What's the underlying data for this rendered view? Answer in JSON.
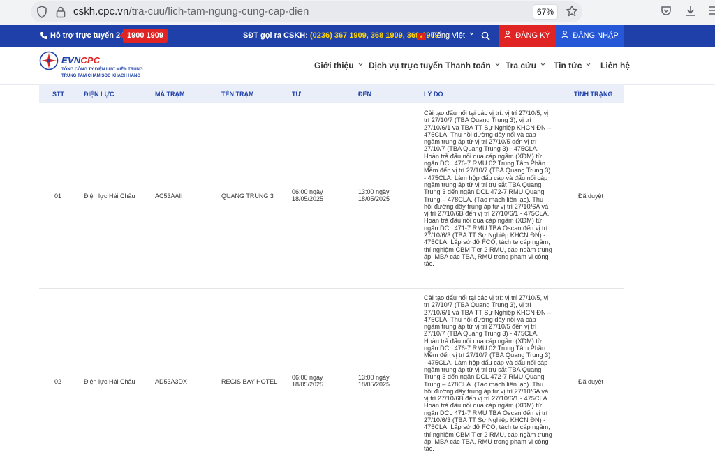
{
  "browser": {
    "url_host": "cskh.cpc.vn",
    "url_path": "/tra-cuu/lich-tam-ngung-cung-cap-dien",
    "zoom": "67%"
  },
  "topbar": {
    "hotline_label": "Hỗ trợ trực tuyến 24/7:",
    "hotline_number": "1900 1909",
    "cskh_label": "SĐT gọi ra CSKH:",
    "cskh_numbers": "(0236) 367 1909, 368 1909, 369 1909",
    "language": "Tiếng Việt",
    "register": "ĐĂNG KÝ",
    "login": "ĐĂNG NHẬP"
  },
  "header": {
    "logo_evn": "EVN",
    "logo_cpc": "CPC",
    "logo_sub1": "TỔNG CÔNG TY ĐIỆN LỰC MIỀN TRUNG",
    "logo_sub2": "TRUNG TÂM CHĂM SÓC KHÁCH HÀNG",
    "nav": [
      "Giới thiệu",
      "Dịch vụ trực tuyến",
      "Thanh toán",
      "Tra cứu",
      "Tin tức",
      "Liên hệ"
    ]
  },
  "table": {
    "columns": [
      "STT",
      "ĐIỆN LỰC",
      "MÃ TRẠM",
      "TÊN TRẠM",
      "TỪ",
      "ĐẾN",
      "LÝ DO",
      "TÌNH TRẠNG"
    ],
    "rows": [
      {
        "stt": "01",
        "dien_luc": "Điện lực Hải Châu",
        "ma_tram": "AC53AAII",
        "ten_tram": "QUANG TRUNG 3",
        "tu_1": "06:00 ngày",
        "tu_2": "18/05/2025",
        "den_1": "13:00 ngày",
        "den_2": "18/05/2025",
        "ly_do": "Cải tạo đấu nối tại các vị trí: vị trí 27/10/5, vị trí 27/10/7 (TBA Quang Trung 3), vị trí 27/10/6/1 và TBA TT Sự Nghiệp KHCN ĐN – 475CLA. Thu hồi đường dây nổi và cáp ngầm trung áp từ vị trí 27/10/5 đến vị trí 27/10/7 (TBA Quang Trung 3) - 475CLA. Hoàn trả đấu nối qua cáp ngầm (XDM) từ ngăn DCL 476-7 RMU 02 Trung Tâm Phần Mềm đến vị trí 27/10/7 (TBA Quang Trung 3) - 475CLA. Làm hộp đấu cáp và đấu nối cáp ngầm trung áp từ vị trí trụ sắt TBA Quang Trung 3 đến ngăn DCL 472-7 RMU Quang Trung – 478CLA. (Tạo mạch liên lạc). Thu hồi đường dây trung áp từ vị trí 27/10/6A và vị trí 27/10/6B đến vị trí 27/10/6/1 - 475CLA. Hoàn trả đấu nối qua cáp ngầm (XDM) từ ngăn DCL 471-7 RMU TBA Oscan đến vị trí 27/10/6/3 (TBA TT Sự Nghiệp KHCN ĐN) - 475CLA. Lắp sứ đỡ FCO, tách te cáp ngầm, thí nghiệm CBM Tier 2 RMU, cáp ngầm trung áp, MBA các TBA, RMU trong phạm vi công tác.",
        "tinh_trang": "Đã duyệt"
      },
      {
        "stt": "02",
        "dien_luc": "Điện lực Hải Châu",
        "ma_tram": "AD53A3DX",
        "ten_tram": "REGIS BAY HOTEL",
        "tu_1": "06:00 ngày",
        "tu_2": "18/05/2025",
        "den_1": "13:00 ngày",
        "den_2": "18/05/2025",
        "ly_do": "Cải tạo đấu nối tại các vị trí: vị trí 27/10/5, vị trí 27/10/7 (TBA Quang Trung 3), vị trí 27/10/6/1 và TBA TT Sự Nghiệp KHCN ĐN – 475CLA. Thu hồi đường dây nổi và cáp ngầm trung áp từ vị trí 27/10/5 đến vị trí 27/10/7 (TBA Quang Trung 3) - 475CLA. Hoàn trả đấu nối qua cáp ngầm (XDM) từ ngăn DCL 476-7 RMU 02 Trung Tâm Phần Mềm đến vị trí 27/10/7 (TBA Quang Trung 3) - 475CLA. Làm hộp đấu cáp và đấu nối cáp ngầm trung áp từ vị trí trụ sắt TBA Quang Trung 3 đến ngăn DCL 472-7 RMU Quang Trung – 478CLA. (Tạo mạch liên lạc). Thu hồi đường dây trung áp từ vị trí 27/10/6A và vị trí 27/10/6B đến vị trí 27/10/6/1 - 475CLA. Hoàn trả đấu nối qua cáp ngầm (XDM) từ ngăn DCL 471-7 RMU TBA Oscan đến vị trí 27/10/6/3 (TBA TT Sự Nghiệp KHCN ĐN) - 475CLA. Lắp sứ đỡ FCO, tách te cáp ngầm, thí nghiệm CBM Tier 2 RMU, cáp ngầm trung áp, MBA các TBA, RMU trong phạm vi công tác.",
        "tinh_trang": "Đã duyệt"
      }
    ]
  }
}
